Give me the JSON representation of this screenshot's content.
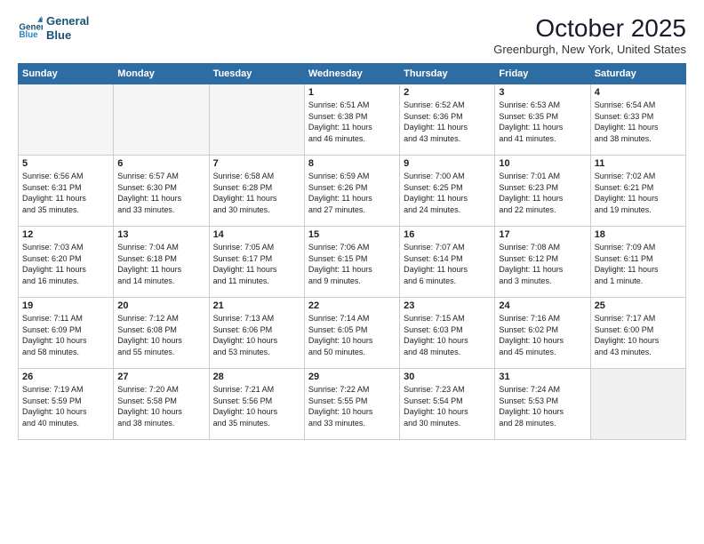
{
  "header": {
    "logo_line1": "General",
    "logo_line2": "Blue",
    "month": "October 2025",
    "location": "Greenburgh, New York, United States"
  },
  "days_of_week": [
    "Sunday",
    "Monday",
    "Tuesday",
    "Wednesday",
    "Thursday",
    "Friday",
    "Saturday"
  ],
  "weeks": [
    [
      {
        "num": "",
        "info": ""
      },
      {
        "num": "",
        "info": ""
      },
      {
        "num": "",
        "info": ""
      },
      {
        "num": "1",
        "info": "Sunrise: 6:51 AM\nSunset: 6:38 PM\nDaylight: 11 hours\nand 46 minutes."
      },
      {
        "num": "2",
        "info": "Sunrise: 6:52 AM\nSunset: 6:36 PM\nDaylight: 11 hours\nand 43 minutes."
      },
      {
        "num": "3",
        "info": "Sunrise: 6:53 AM\nSunset: 6:35 PM\nDaylight: 11 hours\nand 41 minutes."
      },
      {
        "num": "4",
        "info": "Sunrise: 6:54 AM\nSunset: 6:33 PM\nDaylight: 11 hours\nand 38 minutes."
      }
    ],
    [
      {
        "num": "5",
        "info": "Sunrise: 6:56 AM\nSunset: 6:31 PM\nDaylight: 11 hours\nand 35 minutes."
      },
      {
        "num": "6",
        "info": "Sunrise: 6:57 AM\nSunset: 6:30 PM\nDaylight: 11 hours\nand 33 minutes."
      },
      {
        "num": "7",
        "info": "Sunrise: 6:58 AM\nSunset: 6:28 PM\nDaylight: 11 hours\nand 30 minutes."
      },
      {
        "num": "8",
        "info": "Sunrise: 6:59 AM\nSunset: 6:26 PM\nDaylight: 11 hours\nand 27 minutes."
      },
      {
        "num": "9",
        "info": "Sunrise: 7:00 AM\nSunset: 6:25 PM\nDaylight: 11 hours\nand 24 minutes."
      },
      {
        "num": "10",
        "info": "Sunrise: 7:01 AM\nSunset: 6:23 PM\nDaylight: 11 hours\nand 22 minutes."
      },
      {
        "num": "11",
        "info": "Sunrise: 7:02 AM\nSunset: 6:21 PM\nDaylight: 11 hours\nand 19 minutes."
      }
    ],
    [
      {
        "num": "12",
        "info": "Sunrise: 7:03 AM\nSunset: 6:20 PM\nDaylight: 11 hours\nand 16 minutes."
      },
      {
        "num": "13",
        "info": "Sunrise: 7:04 AM\nSunset: 6:18 PM\nDaylight: 11 hours\nand 14 minutes."
      },
      {
        "num": "14",
        "info": "Sunrise: 7:05 AM\nSunset: 6:17 PM\nDaylight: 11 hours\nand 11 minutes."
      },
      {
        "num": "15",
        "info": "Sunrise: 7:06 AM\nSunset: 6:15 PM\nDaylight: 11 hours\nand 9 minutes."
      },
      {
        "num": "16",
        "info": "Sunrise: 7:07 AM\nSunset: 6:14 PM\nDaylight: 11 hours\nand 6 minutes."
      },
      {
        "num": "17",
        "info": "Sunrise: 7:08 AM\nSunset: 6:12 PM\nDaylight: 11 hours\nand 3 minutes."
      },
      {
        "num": "18",
        "info": "Sunrise: 7:09 AM\nSunset: 6:11 PM\nDaylight: 11 hours\nand 1 minute."
      }
    ],
    [
      {
        "num": "19",
        "info": "Sunrise: 7:11 AM\nSunset: 6:09 PM\nDaylight: 10 hours\nand 58 minutes."
      },
      {
        "num": "20",
        "info": "Sunrise: 7:12 AM\nSunset: 6:08 PM\nDaylight: 10 hours\nand 55 minutes."
      },
      {
        "num": "21",
        "info": "Sunrise: 7:13 AM\nSunset: 6:06 PM\nDaylight: 10 hours\nand 53 minutes."
      },
      {
        "num": "22",
        "info": "Sunrise: 7:14 AM\nSunset: 6:05 PM\nDaylight: 10 hours\nand 50 minutes."
      },
      {
        "num": "23",
        "info": "Sunrise: 7:15 AM\nSunset: 6:03 PM\nDaylight: 10 hours\nand 48 minutes."
      },
      {
        "num": "24",
        "info": "Sunrise: 7:16 AM\nSunset: 6:02 PM\nDaylight: 10 hours\nand 45 minutes."
      },
      {
        "num": "25",
        "info": "Sunrise: 7:17 AM\nSunset: 6:00 PM\nDaylight: 10 hours\nand 43 minutes."
      }
    ],
    [
      {
        "num": "26",
        "info": "Sunrise: 7:19 AM\nSunset: 5:59 PM\nDaylight: 10 hours\nand 40 minutes."
      },
      {
        "num": "27",
        "info": "Sunrise: 7:20 AM\nSunset: 5:58 PM\nDaylight: 10 hours\nand 38 minutes."
      },
      {
        "num": "28",
        "info": "Sunrise: 7:21 AM\nSunset: 5:56 PM\nDaylight: 10 hours\nand 35 minutes."
      },
      {
        "num": "29",
        "info": "Sunrise: 7:22 AM\nSunset: 5:55 PM\nDaylight: 10 hours\nand 33 minutes."
      },
      {
        "num": "30",
        "info": "Sunrise: 7:23 AM\nSunset: 5:54 PM\nDaylight: 10 hours\nand 30 minutes."
      },
      {
        "num": "31",
        "info": "Sunrise: 7:24 AM\nSunset: 5:53 PM\nDaylight: 10 hours\nand 28 minutes."
      },
      {
        "num": "",
        "info": ""
      }
    ]
  ]
}
